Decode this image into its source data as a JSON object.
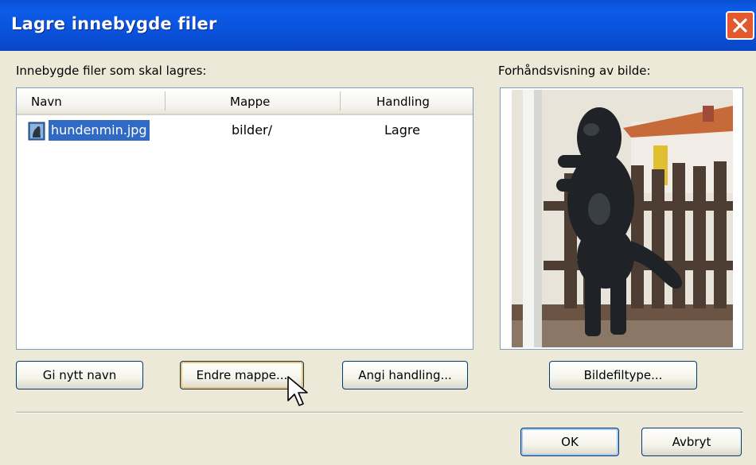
{
  "window": {
    "title": "Lagre innebygde filer"
  },
  "files_label": "Innebygde filer som skal lagres:",
  "preview_label": "Forhåndsvisning av bilde:",
  "table": {
    "columns": [
      "Navn",
      "Mappe",
      "Handling"
    ],
    "rows": [
      {
        "name": "hundenmin.jpg",
        "folder": "bilder/",
        "action": "Lagre"
      }
    ]
  },
  "buttons": {
    "rename": "Gi nytt navn",
    "change_folder": "Endre mappe...",
    "set_action": "Angi handling...",
    "image_file_type": "Bildefiltype...",
    "ok": "OK",
    "cancel": "Avbryt"
  },
  "icons": {
    "close": "close-icon",
    "file": "image-file-icon",
    "cursor": "mouse-pointer-icon"
  },
  "colors": {
    "titlebar": "#0a52dc",
    "selection": "#316ac5",
    "close": "#e2582f",
    "dialog_bg": "#ece9d8"
  }
}
